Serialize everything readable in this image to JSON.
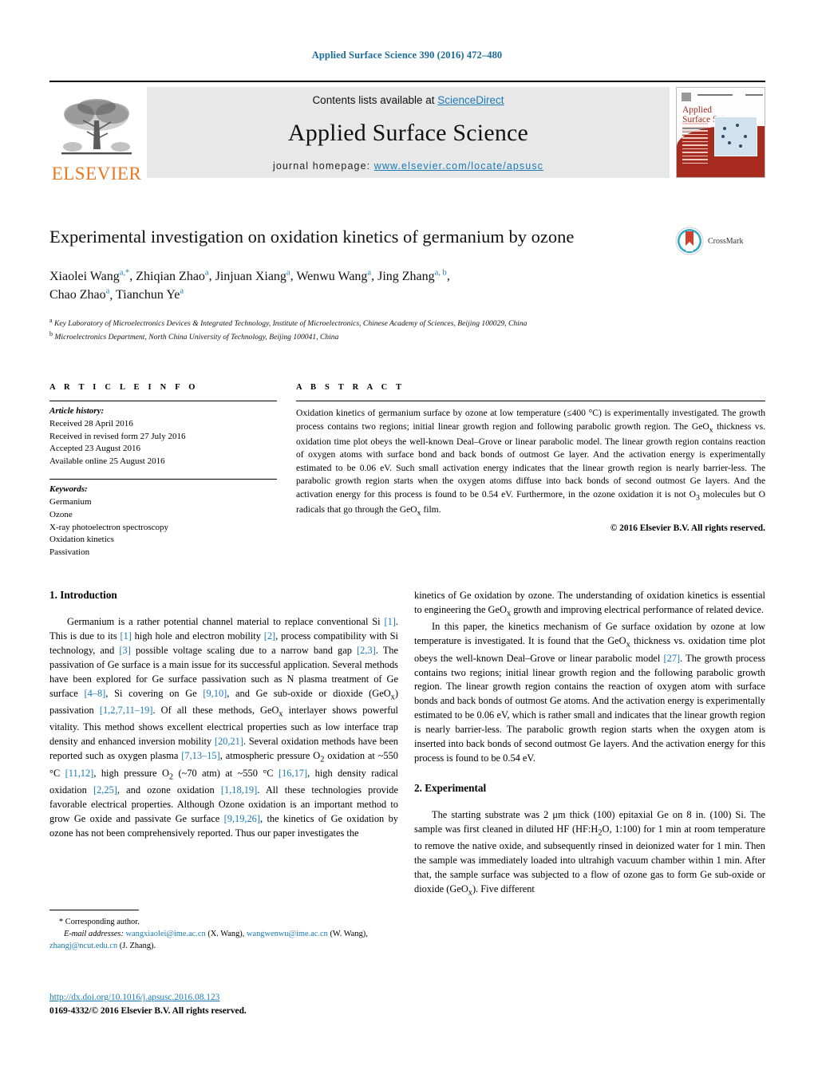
{
  "running_head": "Applied Surface Science 390 (2016) 472–480",
  "header": {
    "contents_prefix": "Contents lists available at ",
    "sciencedirect": "ScienceDirect",
    "journal_title": "Applied Surface Science",
    "homepage_prefix": "journal homepage: ",
    "homepage_url": "www.elsevier.com/locate/apsusc",
    "elsevier_wordmark": "ELSEVIER",
    "cover_title_line1": "Applied",
    "cover_title_line2": "Surface Science",
    "accent_blue": "#1a7ab5",
    "elsevier_orange": "#E87722",
    "cover_red": "#a72b1e"
  },
  "crossmark": {
    "label": "CrossMark"
  },
  "article": {
    "title": "Experimental investigation on oxidation kinetics of germanium by ozone",
    "authors": [
      {
        "name": "Xiaolei Wang",
        "sup": "a,*"
      },
      {
        "name": "Zhiqian Zhao",
        "sup": "a"
      },
      {
        "name": "Jinjuan Xiang",
        "sup": "a"
      },
      {
        "name": "Wenwu Wang",
        "sup": "a"
      },
      {
        "name": "Jing Zhang",
        "sup": "a, b"
      },
      {
        "name": "Chao Zhao",
        "sup": "a"
      },
      {
        "name": "Tianchun Ye",
        "sup": "a"
      }
    ],
    "affiliations": [
      {
        "mark": "a",
        "text": "Key Laboratory of Microelectronics Devices & Integrated Technology, Institute of Microelectronics, Chinese Academy of Sciences, Beijing 100029, China"
      },
      {
        "mark": "b",
        "text": "Microelectronics Department, North China University of Technology, Beijing 100041, China"
      }
    ]
  },
  "article_info": {
    "heading": "A R T I C L E   I N F O",
    "history_label": "Article history:",
    "history": [
      "Received 28 April 2016",
      "Received in revised form 27 July 2016",
      "Accepted 23 August 2016",
      "Available online 25 August 2016"
    ],
    "keywords_label": "Keywords:",
    "keywords": [
      "Germanium",
      "Ozone",
      "X-ray photoelectron spectroscopy",
      "Oxidation kinetics",
      "Passivation"
    ]
  },
  "abstract": {
    "heading": "A B S T R A C T",
    "text": "Oxidation kinetics of germanium surface by ozone at low temperature (≤400 °C) is experimentally investigated. The growth process contains two regions; initial linear growth region and following parabolic growth region. The GeOx thickness vs. oxidation time plot obeys the well-known Deal–Grove or linear parabolic model. The linear growth region contains reaction of oxygen atoms with surface bond and back bonds of outmost Ge layer. And the activation energy is experimentally estimated to be 0.06 eV. Such small activation energy indicates that the linear growth region is nearly barrier-less. The parabolic growth region starts when the oxygen atoms diffuse into back bonds of second outmost Ge layers. And the activation energy for this process is found to be 0.54 eV. Furthermore, in the ozone oxidation it is not O3 molecules but O radicals that go through the GeOx film.",
    "copyright": "© 2016 Elsevier B.V. All rights reserved."
  },
  "sections": {
    "introduction_heading": "1.  Introduction",
    "intro_p1": "Germanium is a rather potential channel material to replace conventional Si [1]. This is due to its [1] high hole and electron mobility [2], process compatibility with Si technology, and [3] possible voltage scaling due to a narrow band gap [2,3]. The passivation of Ge surface is a main issue for its successful application. Several methods have been explored for Ge surface passivation such as N plasma treatment of Ge surface [4–8], Si covering on Ge [9,10], and Ge sub-oxide or dioxide (GeOx) passivation [1,2,7,11–19]. Of all these methods, GeOx interlayer shows powerful vitality. This method shows excellent electrical properties such as low interface trap density and enhanced inversion mobility [20,21]. Several oxidation methods have been reported such as oxygen plasma [7,13–15], atmospheric pressure O2 oxidation at ~550 °C [11,12], high pressure O2 (~70 atm) at ~550 °C [16,17], high density radical oxidation [2,25], and ozone oxidation [1,18,19]. All these technologies provide favorable electrical properties. Although Ozone oxidation is an important method to grow Ge oxide and passivate Ge surface [9,19,26], the kinetics of Ge oxidation by ozone has not been comprehensively reported. Thus our paper investigates the kinetics of Ge oxidation by ozone. The understanding of oxidation kinetics is essential to engineering the GeOx growth and improving electrical performance of related device.",
    "intro_p2": "In this paper, the kinetics mechanism of Ge surface oxidation by ozone at low temperature is investigated. It is found that the GeOx thickness vs. oxidation time plot obeys the well-known Deal–Grove or linear parabolic model [27]. The growth process contains two regions; initial linear growth region and the following parabolic growth region. The linear growth region contains the reaction of oxygen atom with surface bonds and back bonds of outmost Ge atoms. And the activation energy is experimentally estimated to be 0.06 eV, which is rather small and indicates that the linear growth region is nearly barrier-less. The parabolic growth region starts when the oxygen atom is inserted into back bonds of second outmost Ge layers. And the activation energy for this process is found to be 0.54 eV.",
    "experimental_heading": "2.  Experimental",
    "exp_p1": "The starting substrate was 2 μm thick (100) epitaxial Ge on 8 in. (100) Si. The sample was first cleaned in diluted HF (HF:H2O, 1:100) for 1 min at room temperature to remove the native oxide, and subsequently rinsed in deionized water for 1 min. Then the sample was immediately loaded into ultrahigh vacuum chamber within 1 min. After that, the sample surface was subjected to a flow of ozone gas to form Ge sub-oxide or dioxide (GeOx). Five different"
  },
  "footnote": {
    "corresponding": "* Corresponding author.",
    "email_label": "E-mail addresses:",
    "emails": [
      {
        "address": "wangxiaolei@ime.ac.cn",
        "who": "(X. Wang)"
      },
      {
        "address": "wangwenwu@ime.ac.cn",
        "who": "(W. Wang)"
      },
      {
        "address": "zhangj@ncut.edu.cn",
        "who": "(J. Zhang)"
      }
    ]
  },
  "doi_block": {
    "doi_url": "http://dx.doi.org/10.1016/j.apsusc.2016.08.123",
    "issn_line": "0169-4332/© 2016 Elsevier B.V. All rights reserved."
  }
}
